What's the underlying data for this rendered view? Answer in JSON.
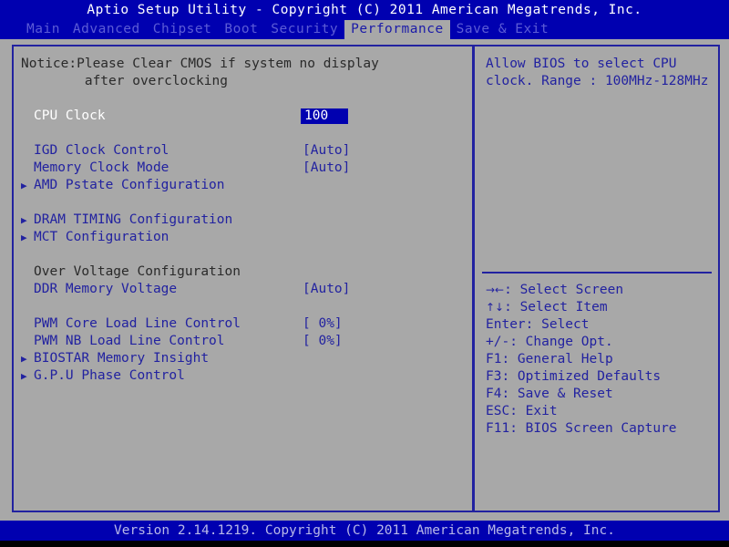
{
  "titlebar": {
    "text": "Aptio Setup Utility - Copyright (C) 2011 American Megatrends, Inc."
  },
  "menubar": {
    "tabs": [
      {
        "label": "Main",
        "active": false
      },
      {
        "label": "Advanced",
        "active": false
      },
      {
        "label": "Chipset",
        "active": false
      },
      {
        "label": "Boot",
        "active": false
      },
      {
        "label": "Security",
        "active": false
      },
      {
        "label": "Performance",
        "active": true
      },
      {
        "label": "Save & Exit",
        "active": false
      }
    ]
  },
  "main": {
    "notice_line1": "Notice:Please Clear CMOS if system no display",
    "notice_line2": "        after overclocking",
    "cpu_clock": {
      "label": "CPU Clock",
      "value": "100"
    },
    "items": [
      {
        "label": "IGD Clock Control",
        "value": "[Auto]",
        "arrow": "",
        "style": "blue"
      },
      {
        "label": "Memory Clock Mode",
        "value": "[Auto]",
        "arrow": "",
        "style": "blue"
      },
      {
        "label": "AMD Pstate Configuration",
        "value": "",
        "arrow": "▶",
        "style": "blue"
      },
      {
        "label": "",
        "value": "",
        "arrow": "",
        "style": "spacer"
      },
      {
        "label": "DRAM TIMING Configuration",
        "value": "",
        "arrow": "▶",
        "style": "blue"
      },
      {
        "label": "MCT Configuration",
        "value": "",
        "arrow": "▶",
        "style": "blue"
      },
      {
        "label": "",
        "value": "",
        "arrow": "",
        "style": "spacer"
      },
      {
        "label": "Over Voltage Configuration",
        "value": "",
        "arrow": "",
        "style": "dark"
      },
      {
        "label": "DDR Memory Voltage",
        "value": "[Auto]",
        "arrow": "",
        "style": "blue"
      },
      {
        "label": "",
        "value": "",
        "arrow": "",
        "style": "spacer"
      },
      {
        "label": "PWM Core Load Line Control",
        "value": "[ 0%]",
        "arrow": "",
        "style": "blue"
      },
      {
        "label": "PWM NB Load Line Control",
        "value": "[ 0%]",
        "arrow": "",
        "style": "blue"
      },
      {
        "label": "BIOSTAR Memory Insight",
        "value": "",
        "arrow": "▶",
        "style": "blue"
      },
      {
        "label": "G.P.U Phase Control",
        "value": "",
        "arrow": "▶",
        "style": "blue"
      }
    ]
  },
  "help": {
    "description": "Allow BIOS to select CPU\nclock. Range : 100MHz-128MHz",
    "keys": [
      {
        "key": "→←",
        "text": ": Select Screen"
      },
      {
        "key": "↑↓",
        "text": ": Select Item"
      },
      {
        "key": "Enter",
        "text": ": Select"
      },
      {
        "key": "+/-",
        "text": ": Change Opt."
      },
      {
        "key": "F1",
        "text": ": General Help"
      },
      {
        "key": "F3",
        "text": ": Optimized Defaults"
      },
      {
        "key": "F4",
        "text": ": Save & Reset"
      },
      {
        "key": "ESC",
        "text": ": Exit"
      },
      {
        "key": "F11",
        "text": ": BIOS Screen Capture"
      }
    ]
  },
  "footer": {
    "text": "Version 2.14.1219. Copyright (C) 2011 American Megatrends, Inc."
  },
  "colors": {
    "blue_bg": "#0000b0",
    "panel_bg": "#a8a8a8",
    "border_blue": "#2222a0",
    "text_blue": "#2222a0",
    "tab_inactive": "#5c5cd6",
    "highlight_bg": "#a8a8a8"
  }
}
